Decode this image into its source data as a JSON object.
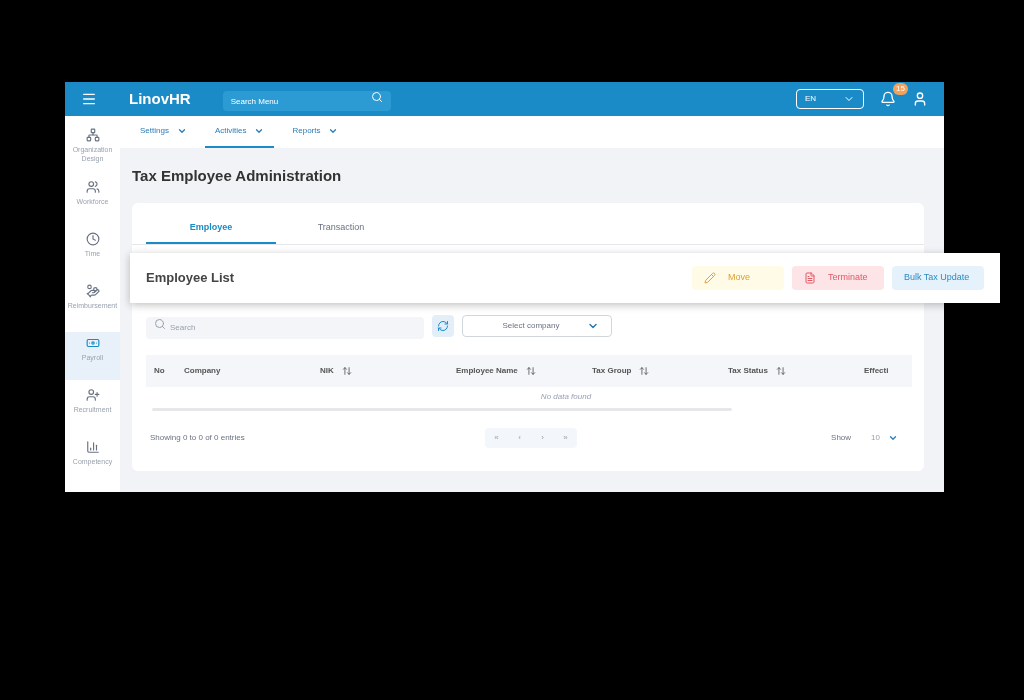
{
  "topbar": {
    "logo": "LinovHR",
    "search": {
      "placeholder": "Search Menu"
    },
    "language": "EN",
    "notifications": "15"
  },
  "subnav": [
    {
      "label": "Settings",
      "selected": false
    },
    {
      "label": "Activities",
      "selected": true
    },
    {
      "label": "Reports",
      "selected": false
    }
  ],
  "sidebar": {
    "items": [
      {
        "label": "Organization Design",
        "kind": "org",
        "selected": false
      },
      {
        "label": "Workforce",
        "kind": "people",
        "selected": false
      },
      {
        "label": "Time",
        "kind": "clock",
        "selected": false
      },
      {
        "label": "Reimbursement",
        "kind": "hand",
        "selected": false
      },
      {
        "label": "Payroll",
        "kind": "money",
        "selected": true
      },
      {
        "label": "Recruitment",
        "kind": "adduser",
        "selected": false
      },
      {
        "label": "Competency",
        "kind": "chart",
        "selected": false
      }
    ]
  },
  "page_title": "Tax Employee Administration",
  "tabs": [
    {
      "label": "Employee",
      "selected": true
    },
    {
      "label": "Transaction",
      "selected": false
    }
  ],
  "list_title": "Employee List",
  "actions": [
    {
      "label": "Move",
      "kind": "move"
    },
    {
      "label": "Terminate",
      "kind": "terminate"
    },
    {
      "label": "Bulk Tax Update",
      "kind": "bulk"
    }
  ],
  "search": {
    "placeholder": "Search"
  },
  "company_select": {
    "placeholder": "Select company"
  },
  "table": {
    "columns": [
      {
        "label": "No",
        "sortable": false
      },
      {
        "label": "Company",
        "sortable": false
      },
      {
        "label": "NIK",
        "sortable": true
      },
      {
        "label": "Employee Name",
        "sortable": true
      },
      {
        "label": "Tax Group",
        "sortable": true
      },
      {
        "label": "Tax Status",
        "sortable": true
      },
      {
        "label": "Effecti",
        "sortable": false
      }
    ],
    "empty": "No data found"
  },
  "footer": {
    "summary": "Showing 0 to 0 of 0 entries",
    "pager": [
      "«",
      "‹",
      "›",
      "»"
    ],
    "show_label": "Show",
    "page_size": "10"
  }
}
